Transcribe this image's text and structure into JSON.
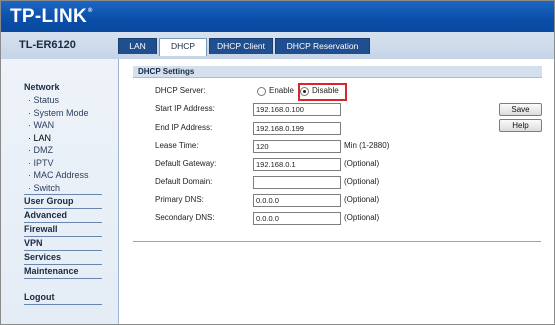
{
  "brand": {
    "logo": "TP-LINK",
    "reg": "®"
  },
  "model": "TL-ER6120",
  "tabs": [
    {
      "label": "LAN",
      "active": false
    },
    {
      "label": "DHCP",
      "active": true
    },
    {
      "label": "DHCP Client",
      "active": false
    },
    {
      "label": "DHCP Reservation",
      "active": false
    }
  ],
  "sidebar": {
    "network": {
      "label": "Network",
      "items": [
        {
          "label": "· Status"
        },
        {
          "label": "· System Mode"
        },
        {
          "label": "· WAN"
        },
        {
          "label": "· LAN",
          "active": true
        },
        {
          "label": "· DMZ"
        },
        {
          "label": "· IPTV"
        },
        {
          "label": "· MAC Address"
        },
        {
          "label": "· Switch"
        }
      ]
    },
    "sections": [
      {
        "label": "User Group"
      },
      {
        "label": "Advanced"
      },
      {
        "label": "Firewall"
      },
      {
        "label": "VPN"
      },
      {
        "label": "Services"
      },
      {
        "label": "Maintenance"
      }
    ],
    "logout": "Logout"
  },
  "panel": {
    "title": "DHCP Settings",
    "dhcp_server": {
      "label": "DHCP Server:",
      "enable": "Enable",
      "disable": "Disable",
      "selected": "Disable"
    },
    "start_ip": {
      "label": "Start IP Address:",
      "value": "192.168.0.100"
    },
    "end_ip": {
      "label": "End IP Address:",
      "value": "192.168.0.199"
    },
    "lease": {
      "label": "Lease Time:",
      "value": "120",
      "hint": "Min (1-2880)"
    },
    "gateway": {
      "label": "Default Gateway:",
      "value": "192.168.0.1",
      "hint": "(Optional)"
    },
    "domain": {
      "label": "Default Domain:",
      "value": "",
      "hint": "(Optional)"
    },
    "primary_dns": {
      "label": "Primary DNS:",
      "value": "0.0.0.0",
      "hint": "(Optional)"
    },
    "secondary_dns": {
      "label": "Secondary DNS:",
      "value": "0.0.0.0",
      "hint": "(Optional)"
    }
  },
  "buttons": {
    "save": "Save",
    "help": "Help"
  },
  "colors": {
    "header_blue": "#0a4ea8",
    "tab_blue": "#1f4f8f",
    "highlight_red": "#d9262c"
  }
}
